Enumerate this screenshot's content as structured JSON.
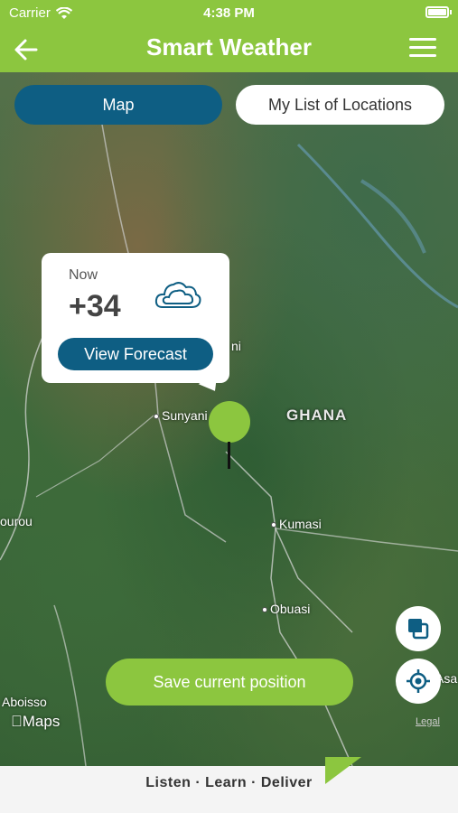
{
  "status_bar": {
    "carrier": "Carrier",
    "time": "4:38 PM"
  },
  "header": {
    "title": "Smart Weather"
  },
  "segments": {
    "map_label": "Map",
    "list_label": "My List of Locations"
  },
  "popup": {
    "now_label": "Now",
    "temperature": "+34",
    "forecast_button": "View Forecast",
    "weather_icon": "cloud-icon"
  },
  "map": {
    "labels": {
      "country": "GHANA",
      "city1": "Sunyani",
      "city2": "Kumasi",
      "city3": "Obuasi",
      "city4": "Aboisso",
      "fragment1": "ni",
      "fragment2": "ourou",
      "fragment3": "Asa"
    },
    "attribution": "Maps",
    "legal": "Legal"
  },
  "actions": {
    "save_button": "Save current position"
  },
  "footer": {
    "slogan": "Listen · Learn · Deliver"
  },
  "colors": {
    "brand_green": "#8cc63f",
    "brand_blue": "#0e5e83"
  }
}
